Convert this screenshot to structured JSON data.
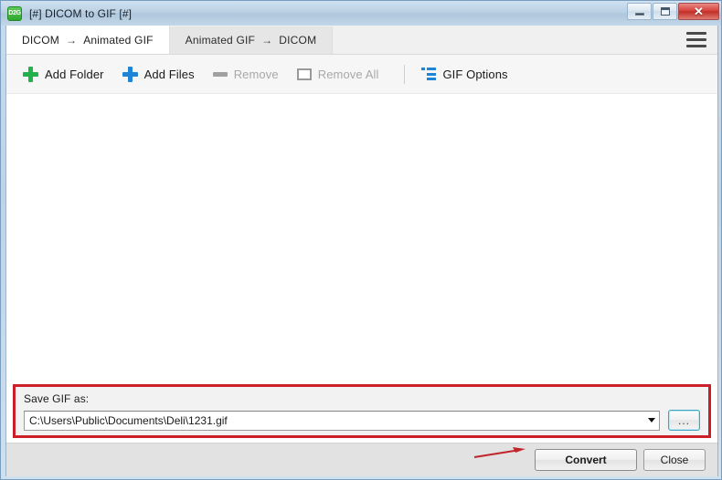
{
  "window": {
    "title": "[#] DICOM to GIF [#]",
    "app_icon_text": "D2G",
    "controls": {
      "minimize": "minimize",
      "maximize": "maximize",
      "close": "✕"
    }
  },
  "tabs": [
    {
      "left": "DICOM",
      "arrow": "→",
      "right": "Animated GIF",
      "active": true
    },
    {
      "left": "Animated GIF",
      "arrow": "→",
      "right": "DICOM",
      "active": false
    }
  ],
  "menu": {
    "hamburger_name": "hamburger-menu-icon"
  },
  "toolbar": {
    "add_folder": "Add Folder",
    "add_files": "Add Files",
    "remove": "Remove",
    "remove_all": "Remove All",
    "gif_options": "GIF Options"
  },
  "file_list": {
    "items": []
  },
  "save_panel": {
    "label": "Save GIF as:",
    "path_value": "C:\\Users\\Public\\Documents\\Deli\\1231.gif",
    "browse_label": "...",
    "highlight_color": "#cc1f27"
  },
  "footer": {
    "convert": "Convert",
    "close": "Close",
    "annotation_arrow_color": "#c0252b"
  },
  "colors": {
    "title_bar": "#b9cfe2",
    "accent_green": "#22b14c",
    "accent_blue": "#1f84d6",
    "disabled_gray": "#a8a8a8",
    "highlight_red": "#cc1f27",
    "browse_focus": "#3ca5c4"
  }
}
